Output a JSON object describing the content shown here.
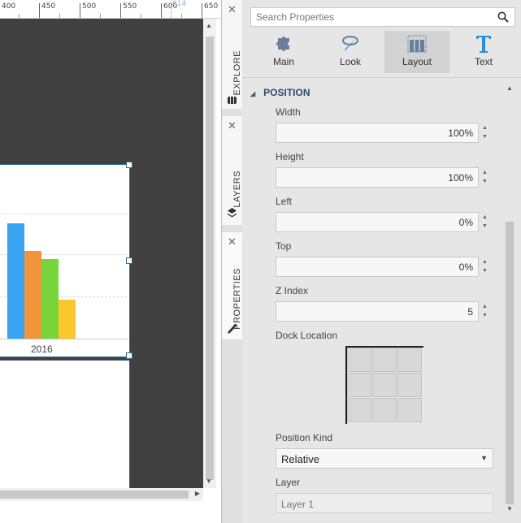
{
  "ruler": {
    "ticks": [
      "400",
      "450",
      "500",
      "550",
      "600",
      "650"
    ],
    "marker": "614"
  },
  "chart": {
    "category": "2016",
    "bars": [
      {
        "label": "blue",
        "value": 1.0,
        "color": "#3ba4f0"
      },
      {
        "label": "orange",
        "value": 0.76,
        "color": "#f0953a"
      },
      {
        "label": "green",
        "value": 0.69,
        "color": "#78d63c"
      },
      {
        "label": "yellow",
        "value": 0.34,
        "color": "#fcc62e"
      }
    ]
  },
  "tabs": [
    {
      "label": "EXPLORE",
      "icon": "database-icon"
    },
    {
      "label": "LAYERS",
      "icon": "layers-icon"
    },
    {
      "label": "PROPERTIES",
      "icon": "pen-icon"
    }
  ],
  "search": {
    "placeholder": "Search Properties",
    "icon": "search-icon"
  },
  "categories": [
    {
      "label": "Main",
      "icon": "puzzle-icon"
    },
    {
      "label": "Look",
      "icon": "brush-icon"
    },
    {
      "label": "Layout",
      "icon": "layout-icon",
      "active": true
    },
    {
      "label": "Text",
      "icon": "text-t-icon"
    }
  ],
  "section": {
    "title": "POSITION"
  },
  "fields": [
    {
      "label": "Width",
      "value": "100%"
    },
    {
      "label": "Height",
      "value": "100%"
    },
    {
      "label": "Left",
      "value": "0%"
    },
    {
      "label": "Top",
      "value": "0%"
    },
    {
      "label": "Z Index",
      "value": "5"
    }
  ],
  "dock": {
    "label": "Dock Location"
  },
  "position_kind": {
    "label": "Position Kind",
    "value": "Relative"
  },
  "layer": {
    "label": "Layer",
    "value": "Layer 1"
  },
  "colors": {
    "accent": "#2b4b6e",
    "selection": "#2e6f8e",
    "canvas_bg": "#404040"
  }
}
